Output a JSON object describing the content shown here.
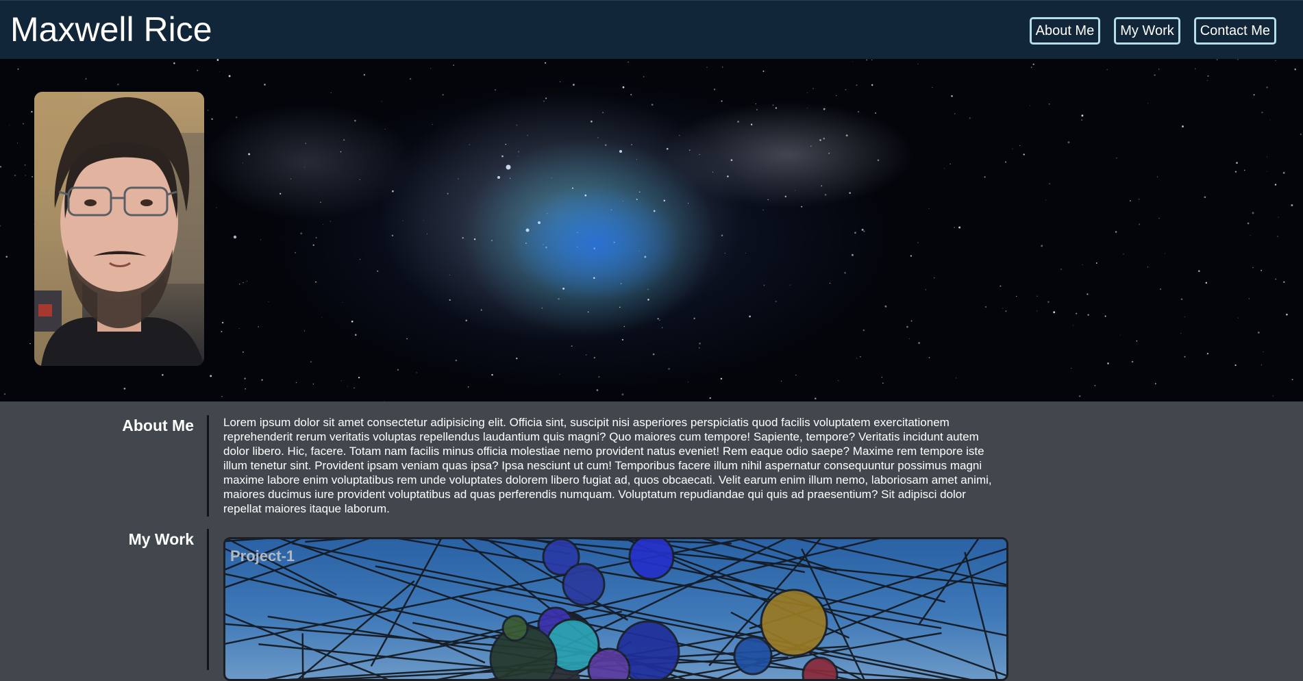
{
  "header": {
    "title": "Maxwell Rice",
    "nav": [
      {
        "label": "About Me"
      },
      {
        "label": "My Work"
      },
      {
        "label": "Contact Me"
      }
    ]
  },
  "hero": {
    "background": "space-nebula-image",
    "portrait": "profile-photo"
  },
  "about": {
    "heading": "About Me",
    "body": "Lorem ipsum dolor sit amet consectetur adipisicing elit. Officia sint, suscipit nisi asperiores perspiciatis quod facilis voluptatem exercitationem reprehenderit rerum veritatis voluptas repellendus laudantium quis magni? Quo maiores cum tempore! Sapiente, tempore? Veritatis incidunt autem dolor libero. Hic, facere. Totam nam facilis minus officia molestiae nemo provident natus eveniet! Rem eaque odio saepe? Maxime rem tempore iste illum tenetur sint. Provident ipsam veniam quas ipsa? Ipsa nesciunt ut cum! Temporibus facere illum nihil aspernatur consequuntur possimus magni maxime labore enim voluptatibus rem unde voluptates dolorem libero fugiat ad, quos obcaecati. Velit earum enim illum nemo, laboriosam amet animi, maiores ducimus iure provident voluptatibus ad quas perferendis numquam. Voluptatum repudiandae qui quis ad praesentium? Sit adipisci dolor repellat maiores itaque laborum."
  },
  "work": {
    "heading": "My Work",
    "projects": [
      {
        "title": "Project-1"
      }
    ]
  },
  "colors": {
    "header_bg": "#12263a",
    "content_bg": "#42474d",
    "nav_border": "#b5dde6",
    "project_title": "#b3b8bf"
  }
}
